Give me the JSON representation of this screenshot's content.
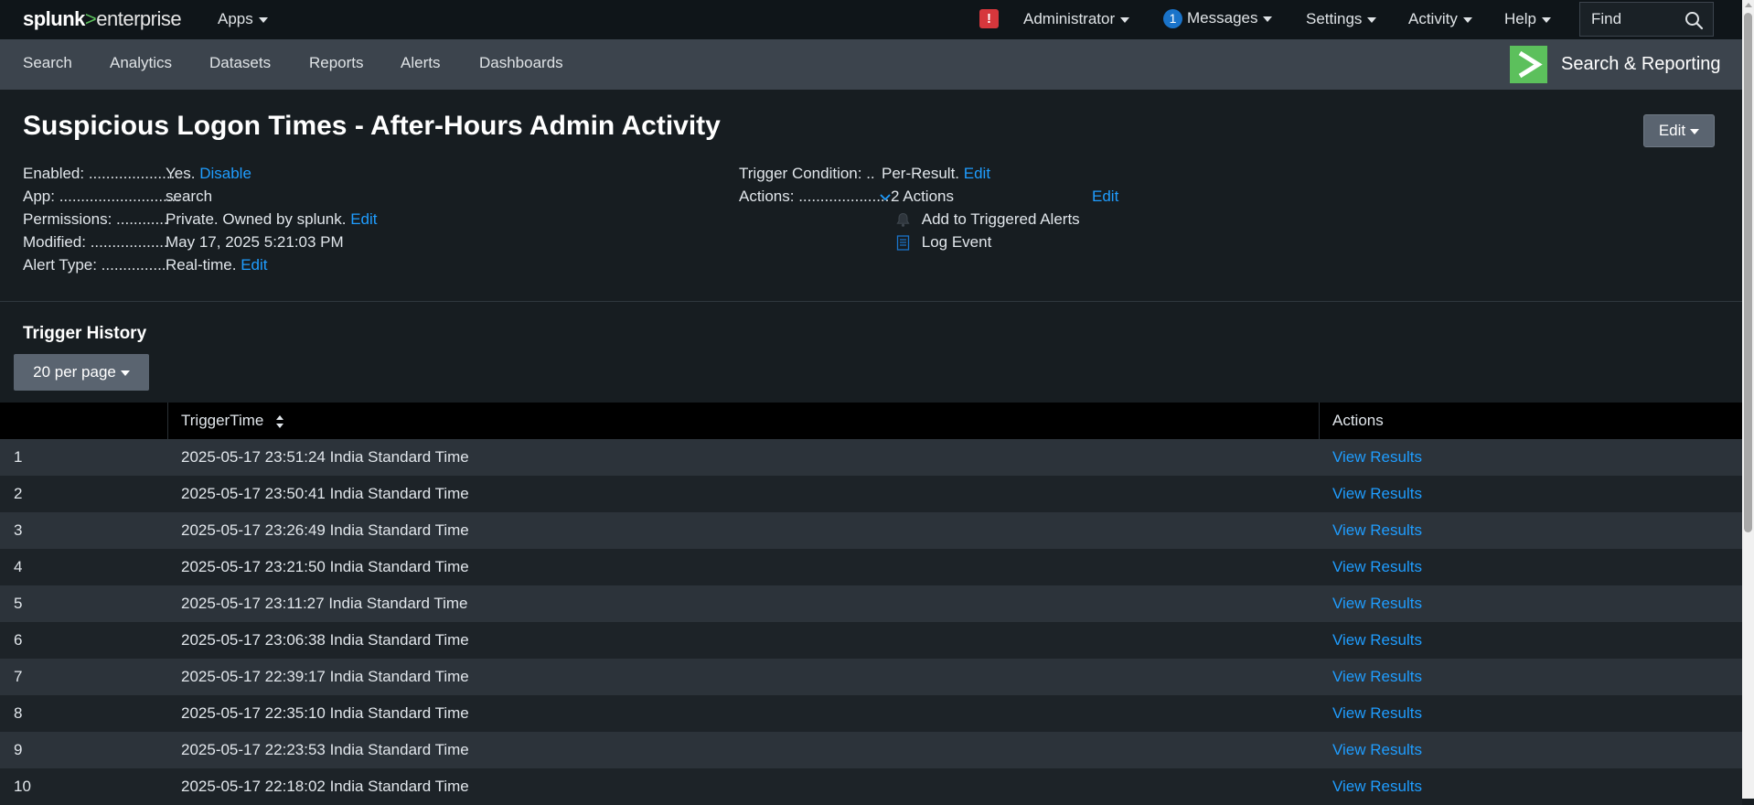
{
  "topbar": {
    "logo_brand": "splunk",
    "logo_gt": ">",
    "logo_product": "enterprise",
    "apps": "Apps",
    "alert_badge": "!",
    "administrator": "Administrator",
    "messages_count": "1",
    "messages": "Messages",
    "settings": "Settings",
    "activity": "Activity",
    "help": "Help",
    "find_placeholder": "Find"
  },
  "appbar": {
    "nav": [
      "Search",
      "Analytics",
      "Datasets",
      "Reports",
      "Alerts",
      "Dashboards"
    ],
    "app_name": "Search & Reporting"
  },
  "alert": {
    "title": "Suspicious Logon Times - After-Hours Admin Activity",
    "edit_button": "Edit",
    "enabled_label": "Enabled: ....................",
    "enabled_value": "Yes.",
    "enabled_link": "Disable",
    "app_label": "App: ............................",
    "app_value": "search",
    "permissions_label": "Permissions: ............",
    "permissions_value": "Private. Owned by splunk.",
    "permissions_link": "Edit",
    "modified_label": "Modified: ..................",
    "modified_value": "May 17, 2025 5:21:03 PM",
    "alert_type_label": "Alert Type: ...............",
    "alert_type_value": "Real-time.",
    "alert_type_link": "Edit",
    "trigger_label": "Trigger Condition: ..",
    "trigger_value": "Per-Result.",
    "trigger_link": "Edit",
    "actions_label": "Actions: .....................",
    "actions_value": "2 Actions",
    "actions_link": "Edit",
    "action_items": [
      "Add to Triggered Alerts",
      "Log Event"
    ]
  },
  "history": {
    "title": "Trigger History",
    "per_page": "20 per page",
    "columns": [
      "TriggerTime",
      "Actions"
    ],
    "rows": [
      {
        "n": "1",
        "time": "2025-05-17 23:51:24 India Standard Time",
        "action": "View Results"
      },
      {
        "n": "2",
        "time": "2025-05-17 23:50:41 India Standard Time",
        "action": "View Results"
      },
      {
        "n": "3",
        "time": "2025-05-17 23:26:49 India Standard Time",
        "action": "View Results"
      },
      {
        "n": "4",
        "time": "2025-05-17 23:21:50 India Standard Time",
        "action": "View Results"
      },
      {
        "n": "5",
        "time": "2025-05-17 23:11:27 India Standard Time",
        "action": "View Results"
      },
      {
        "n": "6",
        "time": "2025-05-17 23:06:38 India Standard Time",
        "action": "View Results"
      },
      {
        "n": "7",
        "time": "2025-05-17 22:39:17 India Standard Time",
        "action": "View Results"
      },
      {
        "n": "8",
        "time": "2025-05-17 22:35:10 India Standard Time",
        "action": "View Results"
      },
      {
        "n": "9",
        "time": "2025-05-17 22:23:53 India Standard Time",
        "action": "View Results"
      },
      {
        "n": "10",
        "time": "2025-05-17 22:18:02 India Standard Time",
        "action": "View Results"
      }
    ]
  },
  "colors": {
    "link": "#1f9dff",
    "brand_green": "#5cc05c",
    "alert_red": "#d6373c",
    "badge_blue": "#1a73c9"
  }
}
